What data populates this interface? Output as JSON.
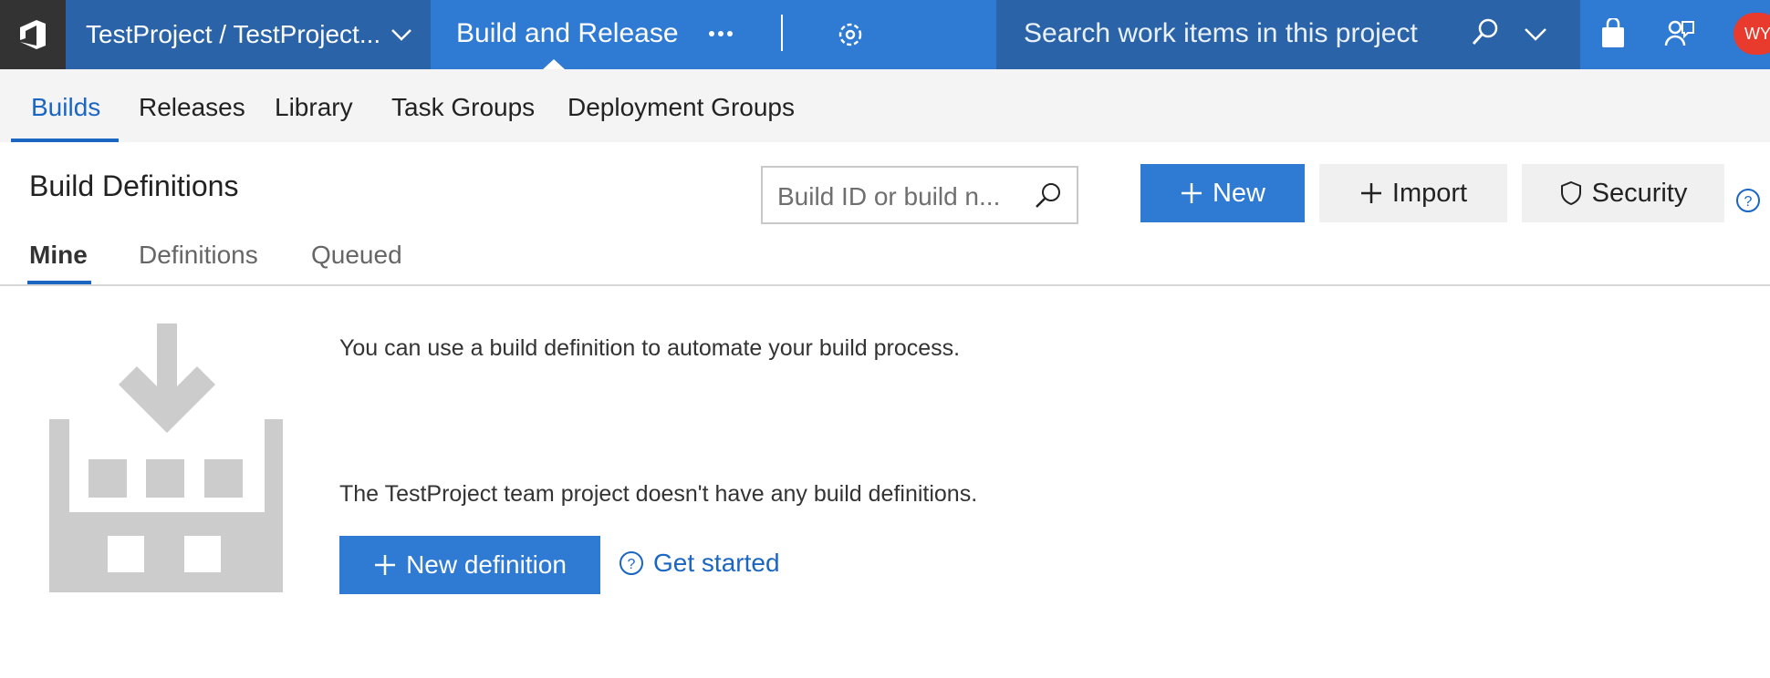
{
  "topbar": {
    "project": "TestProject / TestProject...",
    "hub": "Build and Release",
    "more": "more-icon",
    "settings": "gear-icon",
    "search_placeholder": "Search work items in this project",
    "avatar_initials": "WY"
  },
  "subnav": {
    "items": [
      {
        "label": "Builds",
        "active": true
      },
      {
        "label": "Releases"
      },
      {
        "label": "Library"
      },
      {
        "label": "Task Groups"
      },
      {
        "label": "Deployment Groups"
      }
    ]
  },
  "page": {
    "title": "Build Definitions",
    "filter_placeholder": "Build ID or build n...",
    "new_label": "New",
    "import_label": "Import",
    "security_label": "Security",
    "tabs": [
      {
        "label": "Mine",
        "active": true
      },
      {
        "label": "Definitions"
      },
      {
        "label": "Queued"
      }
    ]
  },
  "empty_state": {
    "message1": "You can use a build definition to automate your build process.",
    "message2": "The TestProject team project doesn't have any build definitions.",
    "new_definition_label": "New definition",
    "get_started_label": "Get started"
  },
  "colors": {
    "accent": "#2f7ad3",
    "header_dark": "#2a63a8",
    "link": "#1a66c2",
    "illustration": "#cccccc"
  }
}
